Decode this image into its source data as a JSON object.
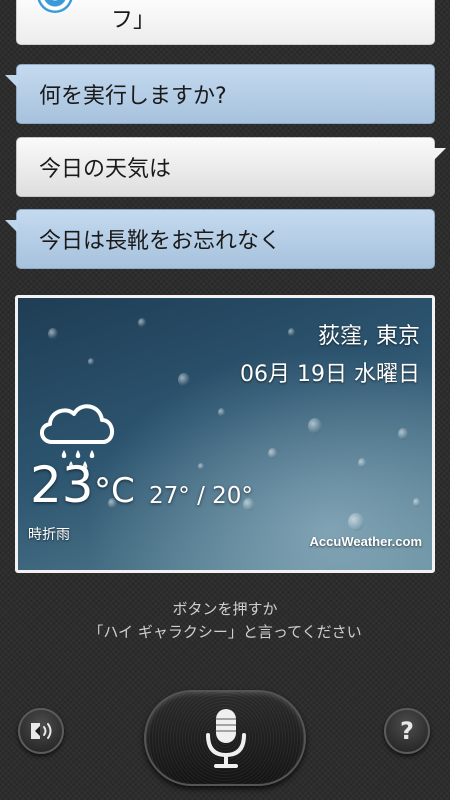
{
  "conversation": {
    "previous_reply_fragment": "フ」",
    "messages": [
      {
        "speaker": "assistant",
        "text": "何を実行しますか?"
      },
      {
        "speaker": "user",
        "text": "今日の天気は"
      },
      {
        "speaker": "assistant",
        "text": "今日は長靴をお忘れなく"
      }
    ]
  },
  "weather": {
    "location": "荻窪, 東京",
    "date": "06月 19日 水曜日",
    "current_temp": "23",
    "unit": "°C",
    "high_low": "27° / 20°",
    "condition": "時折雨",
    "provider": "AccuWeather.com",
    "icon": "cloud-rain-icon"
  },
  "prompt": {
    "line1": "ボタンを押すか",
    "line2": "「ハイ ギャラクシー」と言ってください"
  },
  "controls": {
    "speaker_icon": "speaker-output-icon",
    "mic_icon": "microphone-icon",
    "help_icon": "help-icon",
    "help_label": "?"
  }
}
